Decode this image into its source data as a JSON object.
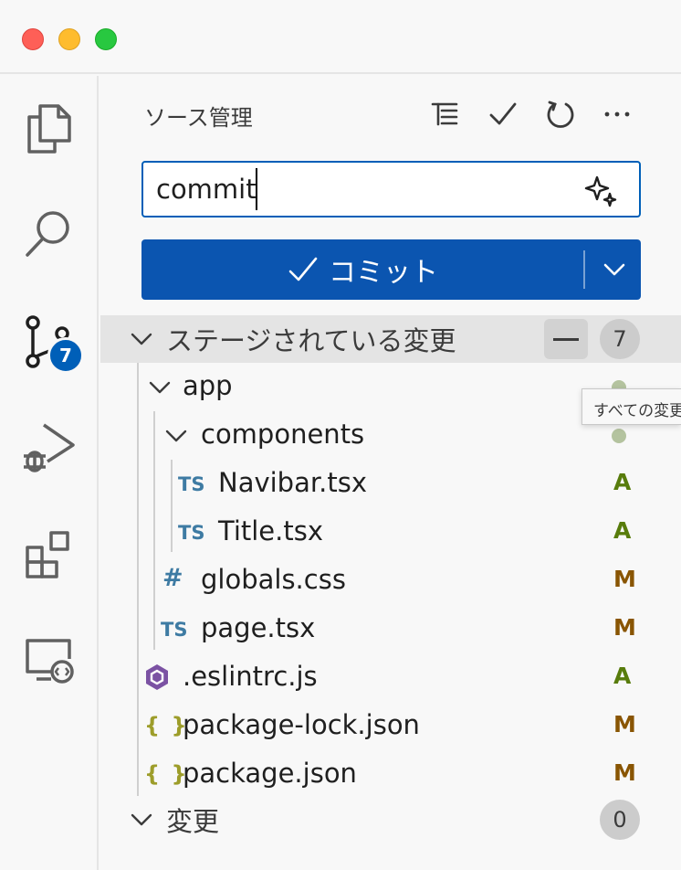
{
  "panel": {
    "title": "ソース管理",
    "toolbar_icons": [
      "view-as-tree-icon",
      "check-icon",
      "refresh-icon",
      "more-icon"
    ]
  },
  "commit": {
    "input_value": "commit",
    "button_label": "コミット"
  },
  "staged": {
    "label": "ステージされている変更",
    "count": "7",
    "tooltip": "すべての変更"
  },
  "tree": [
    {
      "type": "folder",
      "name": "app",
      "depth": 0
    },
    {
      "type": "folder",
      "name": "components",
      "depth": 1
    },
    {
      "type": "file",
      "icon": "TS",
      "name": "Navibar.tsx",
      "status": "A",
      "depth": 2
    },
    {
      "type": "file",
      "icon": "TS",
      "name": "Title.tsx",
      "status": "A",
      "depth": 2
    },
    {
      "type": "file",
      "icon": "#",
      "name": "globals.css",
      "status": "M",
      "depth": 1
    },
    {
      "type": "file",
      "icon": "TS",
      "name": "page.tsx",
      "status": "M",
      "depth": 1
    },
    {
      "type": "file",
      "icon": "eslint",
      "name": ".eslintrc.js",
      "status": "A",
      "depth": 0
    },
    {
      "type": "file",
      "icon": "{ }",
      "name": "package-lock.json",
      "status": "M",
      "depth": 0
    },
    {
      "type": "file",
      "icon": "{ }",
      "name": "package.json",
      "status": "M",
      "depth": 0
    }
  ],
  "changes": {
    "label": "変更",
    "count": "0"
  },
  "activity": {
    "scm_badge": "7",
    "icons": [
      "explorer-icon",
      "search-icon",
      "source-control-icon",
      "run-debug-icon",
      "extensions-icon",
      "remote-explorer-icon"
    ]
  },
  "colors": {
    "accent": "#005fb8",
    "added": "#587c0c",
    "modified": "#895503"
  }
}
